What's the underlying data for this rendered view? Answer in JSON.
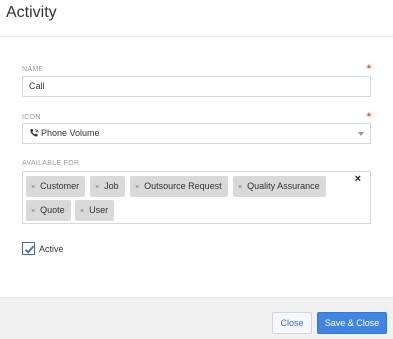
{
  "dialog": {
    "title": "Activity"
  },
  "name_field": {
    "label": "NAME",
    "value": "Call",
    "required_mark": "*"
  },
  "icon_field": {
    "label": "ICON",
    "value": "Phone Volume",
    "icon": "phone-volume-icon",
    "required_mark": "*"
  },
  "available_for": {
    "label": "AVAILABLE FOR",
    "remove_symbol": "×",
    "clear_symbol": "×",
    "tags": [
      "Customer",
      "Job",
      "Outsource Request",
      "Quality Assurance",
      "Quote",
      "User"
    ]
  },
  "active": {
    "label": "Active",
    "checked": true
  },
  "footer": {
    "close_label": "Close",
    "save_label": "Save & Close"
  },
  "colors": {
    "primary": "#3f86e0",
    "required": "#d9534f",
    "tag_bg": "#d9d9d9"
  }
}
